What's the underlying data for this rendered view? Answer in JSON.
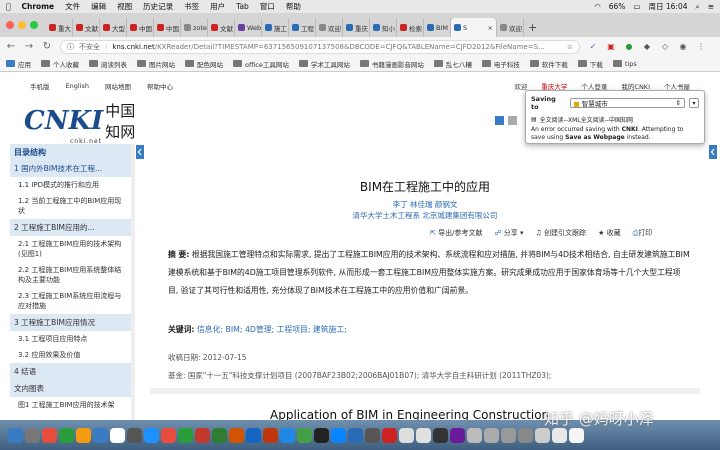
{
  "menubar": {
    "apple": "",
    "app": "Chrome",
    "items": [
      "文件",
      "编辑",
      "视图",
      "历史记录",
      "书签",
      "用户",
      "Tab",
      "窗口",
      "帮助"
    ],
    "battery": "66%",
    "datetime": "周日 16:04"
  },
  "tabs": [
    {
      "label": "重大",
      "color": "#c22"
    },
    {
      "label": "文献",
      "color": "#c22"
    },
    {
      "label": "大型",
      "color": "#c22"
    },
    {
      "label": "中国",
      "color": "#c22"
    },
    {
      "label": "中国",
      "color": "#c22"
    },
    {
      "label": "zoter",
      "color": "#888"
    },
    {
      "label": "文献",
      "color": "#c22"
    },
    {
      "label": "Web",
      "color": "#6b3fa0"
    },
    {
      "label": "施工",
      "color": "#2a6bb5"
    },
    {
      "label": "工程",
      "color": "#2a6bb5"
    },
    {
      "label": "欢迎",
      "color": "#888"
    },
    {
      "label": "重庆",
      "color": "#2a6bb5"
    },
    {
      "label": "知小",
      "color": "#2a6bb5"
    },
    {
      "label": "检索",
      "color": "#c22"
    },
    {
      "label": "BIM",
      "color": "#2a6bb5"
    },
    {
      "label": "S",
      "color": "#2a6bb5"
    },
    {
      "label": "欢迎",
      "color": "#888"
    }
  ],
  "toolbar": {
    "insecure_label": "不安全",
    "url_host": "kns.cnki.net",
    "url_path": "/KXReader/Detail?TIMESTAMP=637156509107137508&DBCODE=CJFQ&TABLEName=CJFD2012&FileName=S..."
  },
  "bookmarks": [
    "应用",
    "个人收藏",
    "阅读列表",
    "图片网站",
    "配色网站",
    "office工具网站",
    "学术工具网站",
    "书籍漫画影音网站",
    "乱七八糟",
    "电子科技",
    "软件下载",
    "下载",
    "tips"
  ],
  "cnki_top": {
    "left": [
      "手机版",
      "English",
      "网站地图",
      "帮助中心"
    ],
    "right": [
      "欢迎",
      "重庆大学",
      "个人登录",
      "我的CNKI",
      "个人书屋"
    ]
  },
  "logo": {
    "mark": "CNKI",
    "cn": "中国知网",
    "net": "cnki.net"
  },
  "sidebar": {
    "title": "目录结构",
    "sections": [
      {
        "label": "1 国内外BIM技术在工程...",
        "active": true,
        "items": [
          "1.1 IPD模式的推行和应用",
          "1.2 当前工程施工中的BIM应用现状"
        ]
      },
      {
        "label": "2 工程施工BIM应用的...",
        "active": false,
        "items": [
          "2.1 工程施工BIM应用的技术架构 (见图1)",
          "2.2 工程施工BIM应用系统整体结构及主要功能",
          "2.3 工程施工BIM系统应用流程与应对措施"
        ]
      },
      {
        "label": "3 工程施工BIM应用情况",
        "active": false,
        "items": [
          "3.1 工程项目应用特点",
          "3.2 应用效果及价值"
        ]
      },
      {
        "label": "4 结语",
        "active": false,
        "items": []
      },
      {
        "label": "文内图表",
        "active": false,
        "items": [
          "图1 工程施工BIM应用的技术架"
        ]
      }
    ]
  },
  "article": {
    "title": "BIM在工程施工中的应用",
    "authors": "李丁  林佳瑞  颜钢文",
    "org": "清华大学土木工程系  北京城建集团有限公司",
    "actions": [
      "导出/参考文献",
      "分享",
      "创建引文跟踪",
      "收藏",
      "打印"
    ],
    "abstract_label": "摘  要:",
    "abstract": "根据我国施工管理特点和实际需求, 提出了工程施工BIM应用的技术架构、系统流程和应对措施, 并将BIM与4D技术相结合, 自主研发建筑施工BIM建模系统和基于BIM的4D施工项目管理系列软件, 从而形成一套工程施工BIM应用整体实施方案。研究成果成功应用于国家体育场等十几个大型工程项目, 验证了其可行性和适用性, 充分体现了BIM技术在工程施工中的应用价值和广阔前景。",
    "keywords_label": "关键词:",
    "keywords": "信息化;  BIM;  4D管理;  工程项目;  建筑施工;",
    "received_label": "收稿日期:",
    "received": "2012-07-15",
    "fund_label": "基金:",
    "fund": "国家\"十一五\"科技支撑计划项目 (2007BAF23B02;2006BAJ01B07); 清华大学自主科研计划 (2011THZ03);",
    "en_title": "Application of BIM in Engineering Construction"
  },
  "popup": {
    "saving_label": "Saving to",
    "folder": "智慧城市",
    "file": "全文阅读--XML全文阅读--中国知网",
    "error_prefix": "An error occurred saving with ",
    "error_bold": "CNKI",
    "error_mid": ". Attempting to save using ",
    "error_bold2": "Save as Webpage",
    "error_suffix": " instead."
  },
  "watermark": "知乎 @妈呀小泽",
  "colors": {
    "cnki_blue": "#1a4b8c",
    "link_blue": "#2a6bb5",
    "sidebar_bg": "#dce8f4"
  }
}
